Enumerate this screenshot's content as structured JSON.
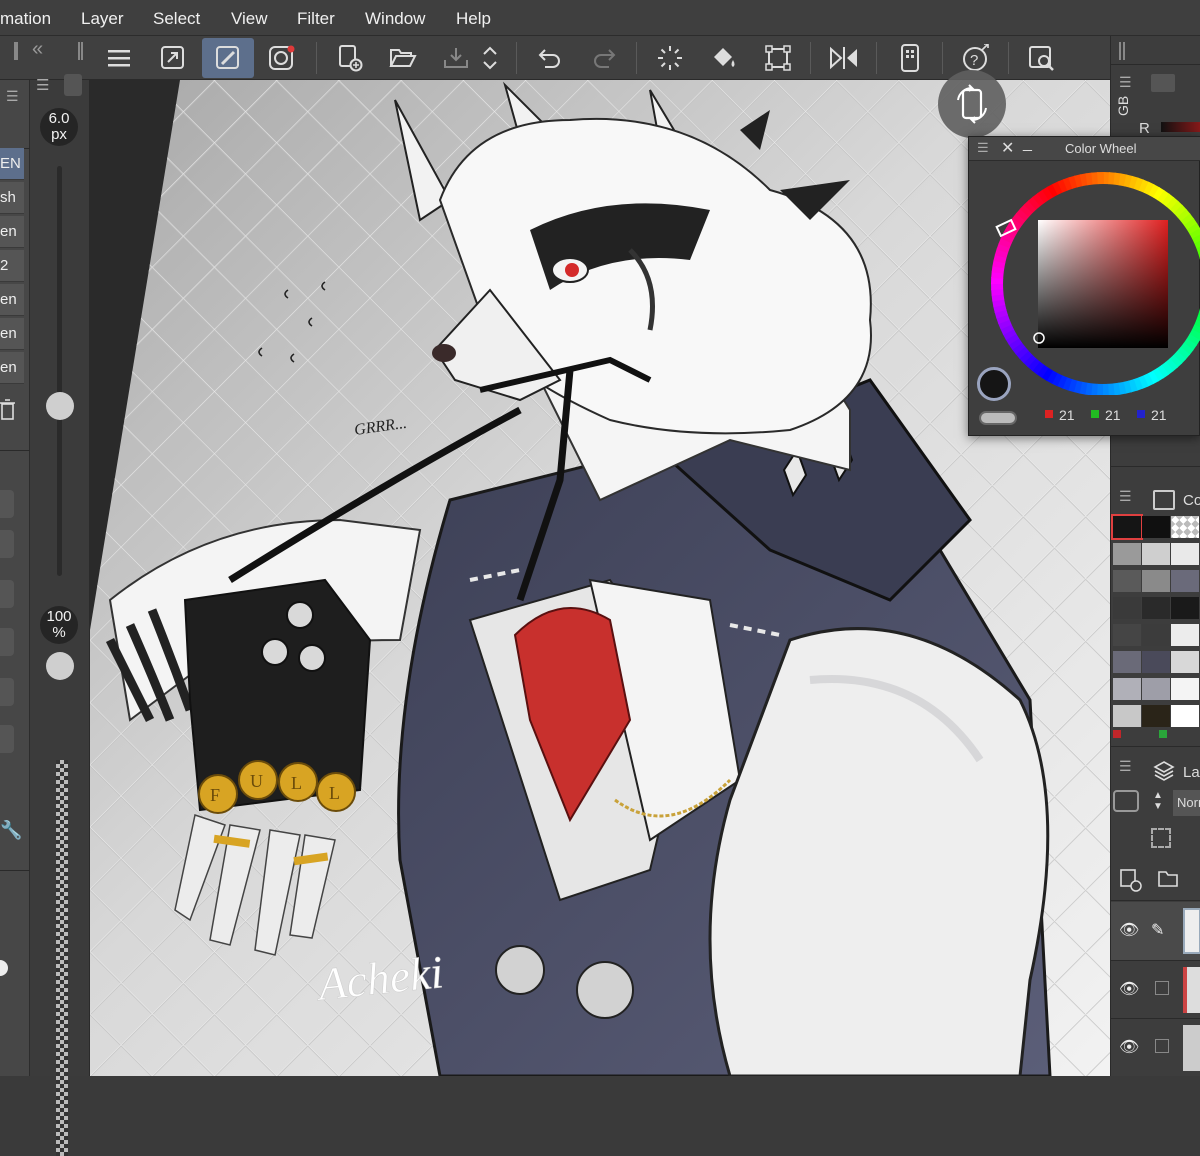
{
  "menu": {
    "items": [
      "mation",
      "Layer",
      "Select",
      "View",
      "Filter",
      "Window",
      "Help"
    ]
  },
  "toolbar": {
    "icons": [
      "menu-icon",
      "resize-icon",
      "transform-pen-icon",
      "record-icon",
      "new-canvas-icon",
      "open-folder-icon",
      "save-tray-icon",
      "spinner-arrows-icon",
      "undo-icon",
      "redo-icon",
      "loading-icon",
      "fill-icon",
      "transform-icon",
      "flip-horizontal-icon",
      "companion-icon",
      "help-icon",
      "search-icon"
    ]
  },
  "brush_panel": {
    "size_value": "6.0",
    "size_unit": "px",
    "opacity_value": "100",
    "opacity_unit": "%",
    "size_slider_level": 0.69,
    "opacity_slider_level": 1.0,
    "brushes": [
      "EN",
      "sh",
      "en",
      "2",
      "en",
      "en",
      "en"
    ]
  },
  "color_wheel": {
    "title": "Color Wheel",
    "r": "21",
    "g": "21",
    "b": "21",
    "main_color": "#151515",
    "sub_color": "#ffffff"
  },
  "right_dock": {
    "rgb_label": "GB",
    "r_label": "R",
    "color_set_label": "Co",
    "layer_label": "La",
    "blend_mode": "Norr"
  },
  "artwork": {
    "signature": "Acheki",
    "speech": "GRRR...",
    "knuckle_text": [
      "F",
      "U",
      "L",
      "L"
    ]
  },
  "colors": {
    "accent": "#5d6f8c",
    "panel": "#404040",
    "vest": "#494c63",
    "inner_shirt": "#c8302d"
  }
}
